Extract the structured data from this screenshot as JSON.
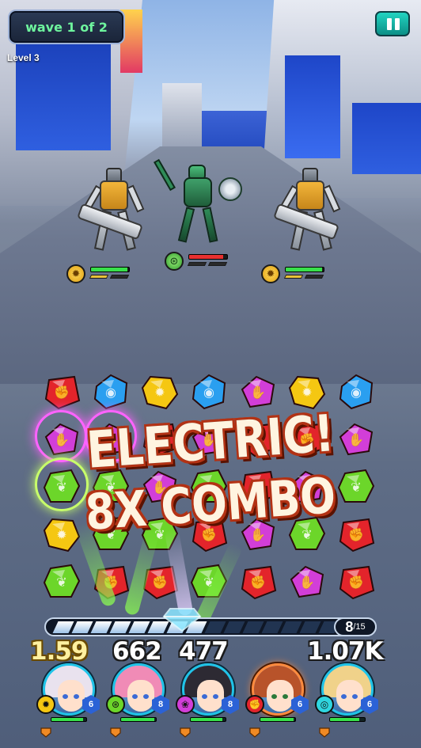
{
  "hud": {
    "wave_label": "wave 1 of 2",
    "level_label": "Level 3",
    "pause_icon": "pause-icon"
  },
  "enemies": [
    {
      "type": "gold-gunner",
      "element": "gold",
      "hp": 0.95,
      "bar_color": "#38e04a"
    },
    {
      "type": "green-mech",
      "element": "green",
      "hp": 0.9,
      "bar_color": "#e83030"
    },
    {
      "type": "gold-gunner",
      "element": "gold",
      "hp": 0.95,
      "bar_color": "#38e04a"
    }
  ],
  "combo": {
    "line1": "ELECTRIC!",
    "line2": "8X COMBO"
  },
  "meter": {
    "current": "8",
    "max": "/15",
    "fill": 0.53
  },
  "damage": {
    "left": "1.59",
    "middle": "662",
    "middle_suffix": "477",
    "right": "1.07K"
  },
  "heroes": [
    {
      "name": "hero-blonde-wink",
      "element": "gold",
      "level": "6",
      "hp": 0.9,
      "hair": "#e9e2ee",
      "active": false
    },
    {
      "name": "hero-pink-hair",
      "element": "green",
      "level": "8",
      "hp": 0.95,
      "hair": "#f08bb6",
      "active": false
    },
    {
      "name": "hero-dark-hair",
      "element": "purple",
      "level": "8",
      "hp": 0.9,
      "hair": "#2d2a33",
      "active": false
    },
    {
      "name": "hero-red-hair",
      "element": "red",
      "level": "6",
      "hp": 0.95,
      "hair": "#b8532a",
      "active": true
    },
    {
      "name": "hero-blonde-braid",
      "element": "blue",
      "level": "6",
      "hp": 0.85,
      "hair": "#f0d28a",
      "active": false
    }
  ],
  "board": {
    "rows": [
      [
        "red",
        "blue",
        "yellow",
        "blue",
        "purple",
        "yellow",
        "blue"
      ],
      [
        "purple",
        "purple",
        "red",
        "purple",
        "red",
        "red",
        "purple"
      ],
      [
        "green",
        "green",
        "purple",
        "green",
        "red",
        "purple",
        "green"
      ],
      [
        "yellow",
        "green",
        "green",
        "red",
        "purple",
        "green",
        "red"
      ],
      [
        "green",
        "red",
        "red",
        "green",
        "red",
        "purple",
        "red"
      ]
    ],
    "colors": {
      "red": "#e3242b",
      "blue": "#2a9ff0",
      "yellow": "#f5c712",
      "purple": "#d23ed8",
      "green": "#6cd62a"
    }
  }
}
